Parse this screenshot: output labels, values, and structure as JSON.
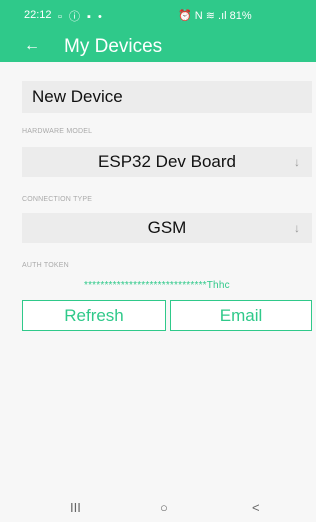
{
  "status": {
    "time": "22:12",
    "left_icons": "▫ ⓘ ▪ •",
    "right_icons": "⏰ N ≋ .ıl 81%",
    "battery": "81%"
  },
  "appbar": {
    "back_icon": "←",
    "title": "My Devices"
  },
  "device": {
    "name_value": "New Device"
  },
  "hardware": {
    "label": "HARDWARE MODEL",
    "value": "ESP32 Dev Board",
    "arrow_icon": "↓"
  },
  "connection": {
    "label": "CONNECTION TYPE",
    "value": "GSM",
    "arrow_icon": "↓"
  },
  "auth": {
    "label": "AUTH TOKEN",
    "value": "******************************Thhc"
  },
  "buttons": {
    "refresh": "Refresh",
    "email": "Email"
  },
  "navbar": {
    "recents": "III",
    "home": "○",
    "back": "<"
  },
  "colors": {
    "accent": "#2fc98a",
    "field_bg": "#ececec",
    "label": "#aaaaaa"
  }
}
